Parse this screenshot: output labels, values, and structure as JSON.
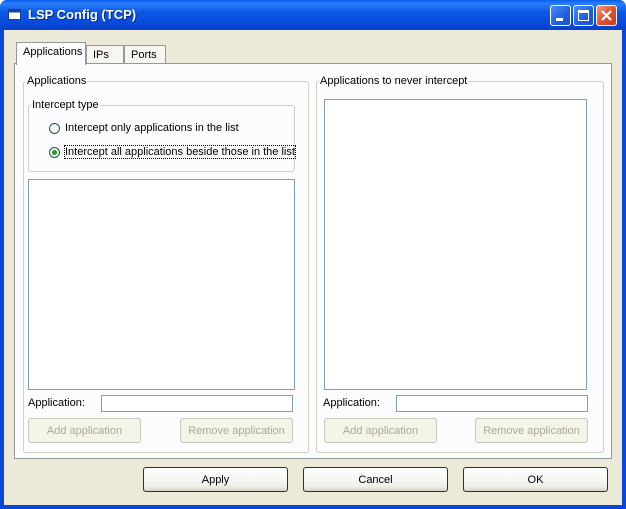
{
  "window": {
    "title": "LSP Config (TCP)"
  },
  "tabs": [
    {
      "label": "Applications",
      "active": true
    },
    {
      "label": "IPs",
      "active": false
    },
    {
      "label": "Ports",
      "active": false
    }
  ],
  "left_group": {
    "title": "Applications",
    "intercept": {
      "title": "Intercept type",
      "options": [
        {
          "label": "Intercept only applications in the list",
          "checked": false
        },
        {
          "label": "Intercept all applications beside those in the list",
          "checked": true
        }
      ]
    },
    "app_label": "Application:",
    "app_value": "",
    "add_button": "Add application",
    "remove_button": "Remove application"
  },
  "right_group": {
    "title": "Applications to never intercept",
    "app_label": "Application:",
    "app_value": "",
    "add_button": "Add application",
    "remove_button": "Remove application"
  },
  "footer": {
    "apply": "Apply",
    "cancel": "Cancel",
    "ok": "OK"
  },
  "colors": {
    "titlebar": "#0a5cf0",
    "dialog_bg": "#ece9d8",
    "panel_bg": "#fcfcfe",
    "close_button": "#e0502c"
  }
}
